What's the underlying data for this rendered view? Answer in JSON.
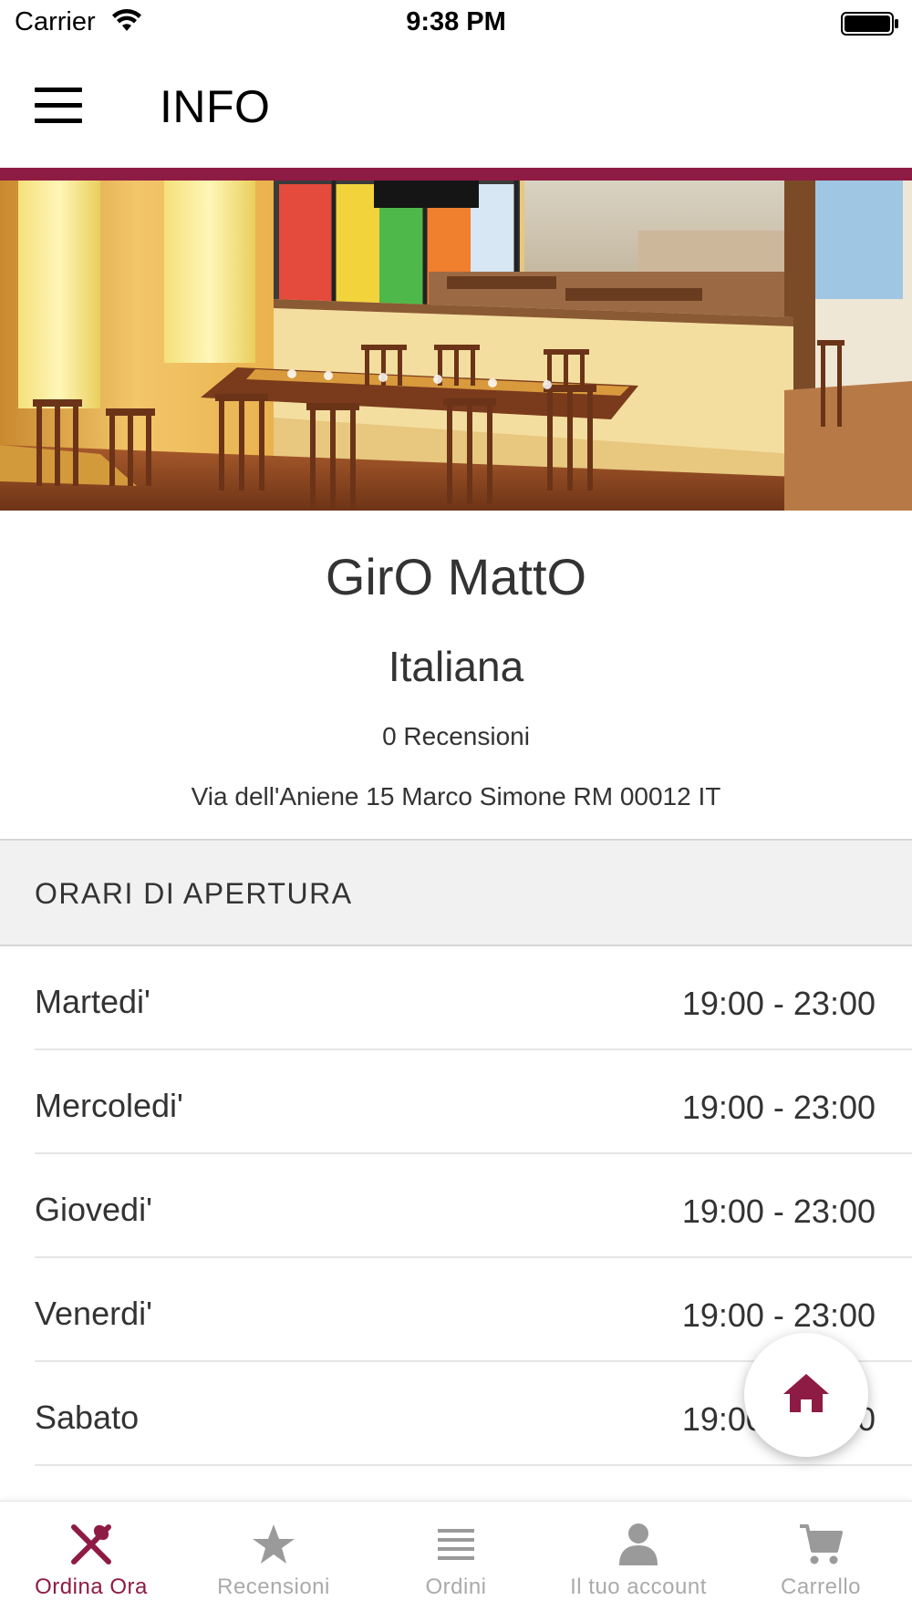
{
  "status_bar": {
    "carrier": "Carrier",
    "time": "9:38 PM"
  },
  "header": {
    "title": "INFO",
    "accent_color": "#8e1b43"
  },
  "restaurant": {
    "name": "GirO MattO",
    "cuisine": "Italiana",
    "reviews": "0 Recensioni",
    "address": "Via dell'Aniene 15 Marco Simone RM 00012 IT"
  },
  "hours": {
    "title": "ORARI DI APERTURA",
    "rows": [
      {
        "day": "Martedi'",
        "time": "19:00 - 23:00"
      },
      {
        "day": "Mercoledi'",
        "time": "19:00 - 23:00"
      },
      {
        "day": "Giovedi'",
        "time": "19:00 - 23:00"
      },
      {
        "day": "Venerdi'",
        "time": "19:00 - 23:00"
      },
      {
        "day": "Sabato",
        "time": "19:00 - 23:00"
      }
    ]
  },
  "fab": {
    "icon": "home-icon"
  },
  "tabs": [
    {
      "label": "Ordina Ora",
      "icon": "fork-knife-icon",
      "active": true
    },
    {
      "label": "Recensioni",
      "icon": "star-icon",
      "active": false
    },
    {
      "label": "Ordini",
      "icon": "list-icon",
      "active": false
    },
    {
      "label": "Il tuo account",
      "icon": "user-icon",
      "active": false
    },
    {
      "label": "Carrello",
      "icon": "cart-icon",
      "active": false
    }
  ]
}
